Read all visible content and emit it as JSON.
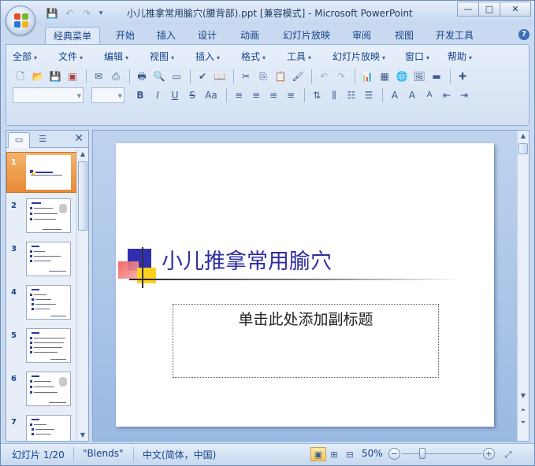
{
  "window": {
    "title": "小儿推拿常用腧穴(腰背部).ppt [兼容模式] - Microsoft PowerPoint",
    "controls": {
      "minimize": "—",
      "maximize": "□",
      "close": "✕"
    }
  },
  "quick_access": {
    "save": "💾",
    "undo": "↶",
    "redo": "↷",
    "customize": "▾"
  },
  "ribbon": {
    "tabs": [
      "经典菜单",
      "开始",
      "插入",
      "设计",
      "动画",
      "幻灯片放映",
      "审阅",
      "视图",
      "开发工具"
    ],
    "help": "?",
    "menus": [
      "全部",
      "文件",
      "编辑",
      "视图",
      "插入",
      "格式",
      "工具",
      "幻灯片放映",
      "窗口",
      "帮助"
    ],
    "menu_arrow": "▾",
    "font_name": "",
    "font_size": ""
  },
  "icons": {
    "new": "🗋",
    "open": "📂",
    "save": "💾",
    "print": "🖶",
    "spell": "✔",
    "cut": "✂",
    "copy": "⎘",
    "paste": "📋",
    "format-painter": "🖌",
    "undo": "↶",
    "redo": "↷",
    "chart": "📊",
    "table": "▦",
    "bold": "B",
    "italic": "I",
    "underline": "U",
    "strike": "S",
    "case": "Aa",
    "align-left": "≡",
    "center": "≡",
    "align-right": "≡",
    "justify": "≡",
    "font-color": "A",
    "grow": "A",
    "shrink": "A"
  },
  "outline_pane": {
    "tab_slides": "▭",
    "tab_outline": "☰",
    "close": "✕",
    "slide_numbers": [
      "1",
      "2",
      "3",
      "4",
      "5",
      "6",
      "7"
    ],
    "selected_index": 0
  },
  "slide": {
    "title": "小儿推拿常用腧穴",
    "subtitle_placeholder": "单击此处添加副标题"
  },
  "status": {
    "slide_info": "幻灯片 1/20",
    "theme": "\"Blends\"",
    "language": "中文(简体，中国)",
    "zoom": "50%",
    "zoom_fraction": 0.5,
    "zoom_minus": "−",
    "zoom_plus": "+",
    "fit": "⤢"
  }
}
